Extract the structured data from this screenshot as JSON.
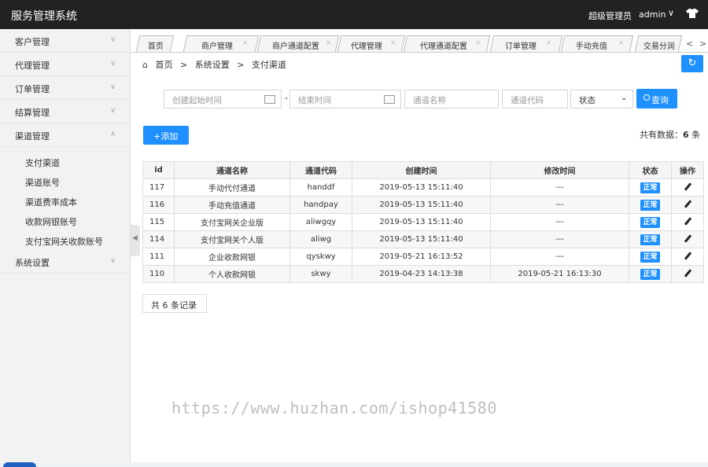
{
  "header": {
    "title": "服务管理系统",
    "role": "超级管理员",
    "username": "admin",
    "caret": "∨"
  },
  "sidebar": {
    "items": [
      {
        "label": "客户管理",
        "caret": "∨"
      },
      {
        "label": "代理管理",
        "caret": "∨"
      },
      {
        "label": "订单管理",
        "caret": "∨"
      },
      {
        "label": "结算管理",
        "caret": "∨"
      },
      {
        "label": "渠道管理",
        "caret": "∧"
      }
    ],
    "subitems": [
      "支付渠道",
      "渠道账号",
      "渠道费率成本",
      "收款网银账号",
      "支付宝网关收款账号"
    ],
    "after": {
      "label": "系统设置",
      "caret": "∨"
    },
    "toggle": "◀"
  },
  "tabs": {
    "items": [
      {
        "label": "首页"
      },
      {
        "label": "商户管理",
        "close": "×"
      },
      {
        "label": "商户通道配置",
        "close": "×"
      },
      {
        "label": "代理管理",
        "close": "×"
      },
      {
        "label": "代理通道配置",
        "close": "×"
      },
      {
        "label": "订单管理",
        "close": "×"
      },
      {
        "label": "手动充值",
        "close": "×"
      },
      {
        "label": "交易分润"
      }
    ],
    "prev": "<",
    "next": ">"
  },
  "breadcrumb": {
    "home_icon": "home-icon",
    "items": [
      "首页",
      "系统设置",
      "支付渠道"
    ],
    "separator": ">"
  },
  "refresh_icon": "refresh-icon",
  "search": {
    "start_placeholder": "创建起始时间",
    "end_placeholder": "结束时间",
    "dash": "-",
    "channel_name_placeholder": "通道名称",
    "channel_code_placeholder": "通道代码",
    "status_selected": "状态",
    "status_caret": "⌄",
    "button_label": "查询"
  },
  "toolbar": {
    "add_label": "+添加",
    "total_prefix": "共有数据：",
    "total_count": "6",
    "total_suffix": " 条"
  },
  "table": {
    "columns": [
      "id",
      "通道名称",
      "通道代码",
      "创建时间",
      "修改时间",
      "状态",
      "操作"
    ],
    "rows": [
      {
        "id": "117",
        "name": "手动代付通道",
        "code": "handdf",
        "created": "2019-05-13 15:11:40",
        "modified": "---",
        "status": "正常"
      },
      {
        "id": "116",
        "name": "手动充值通道",
        "code": "handpay",
        "created": "2019-05-13 15:11:40",
        "modified": "---",
        "status": "正常"
      },
      {
        "id": "115",
        "name": "支付宝网关企业版",
        "code": "aliwgqy",
        "created": "2019-05-13 15:11:40",
        "modified": "---",
        "status": "正常"
      },
      {
        "id": "114",
        "name": "支付宝网关个人版",
        "code": "aliwg",
        "created": "2019-05-13 15:11:40",
        "modified": "---",
        "status": "正常"
      },
      {
        "id": "111",
        "name": "企业收款网银",
        "code": "qyskwy",
        "created": "2019-05-21 16:13:52",
        "modified": "---",
        "status": "正常"
      },
      {
        "id": "110",
        "name": "个人收款网银",
        "code": "skwy",
        "created": "2019-04-23 14:13:38",
        "modified": "2019-05-21 16:13:30",
        "status": "正常"
      }
    ]
  },
  "pagination": {
    "records_label": "共 6 条记录"
  },
  "watermark": "https://www.huzhan.com/ishop41580",
  "colors": {
    "accent": "#1e90ff",
    "header_bg": "#222222"
  }
}
